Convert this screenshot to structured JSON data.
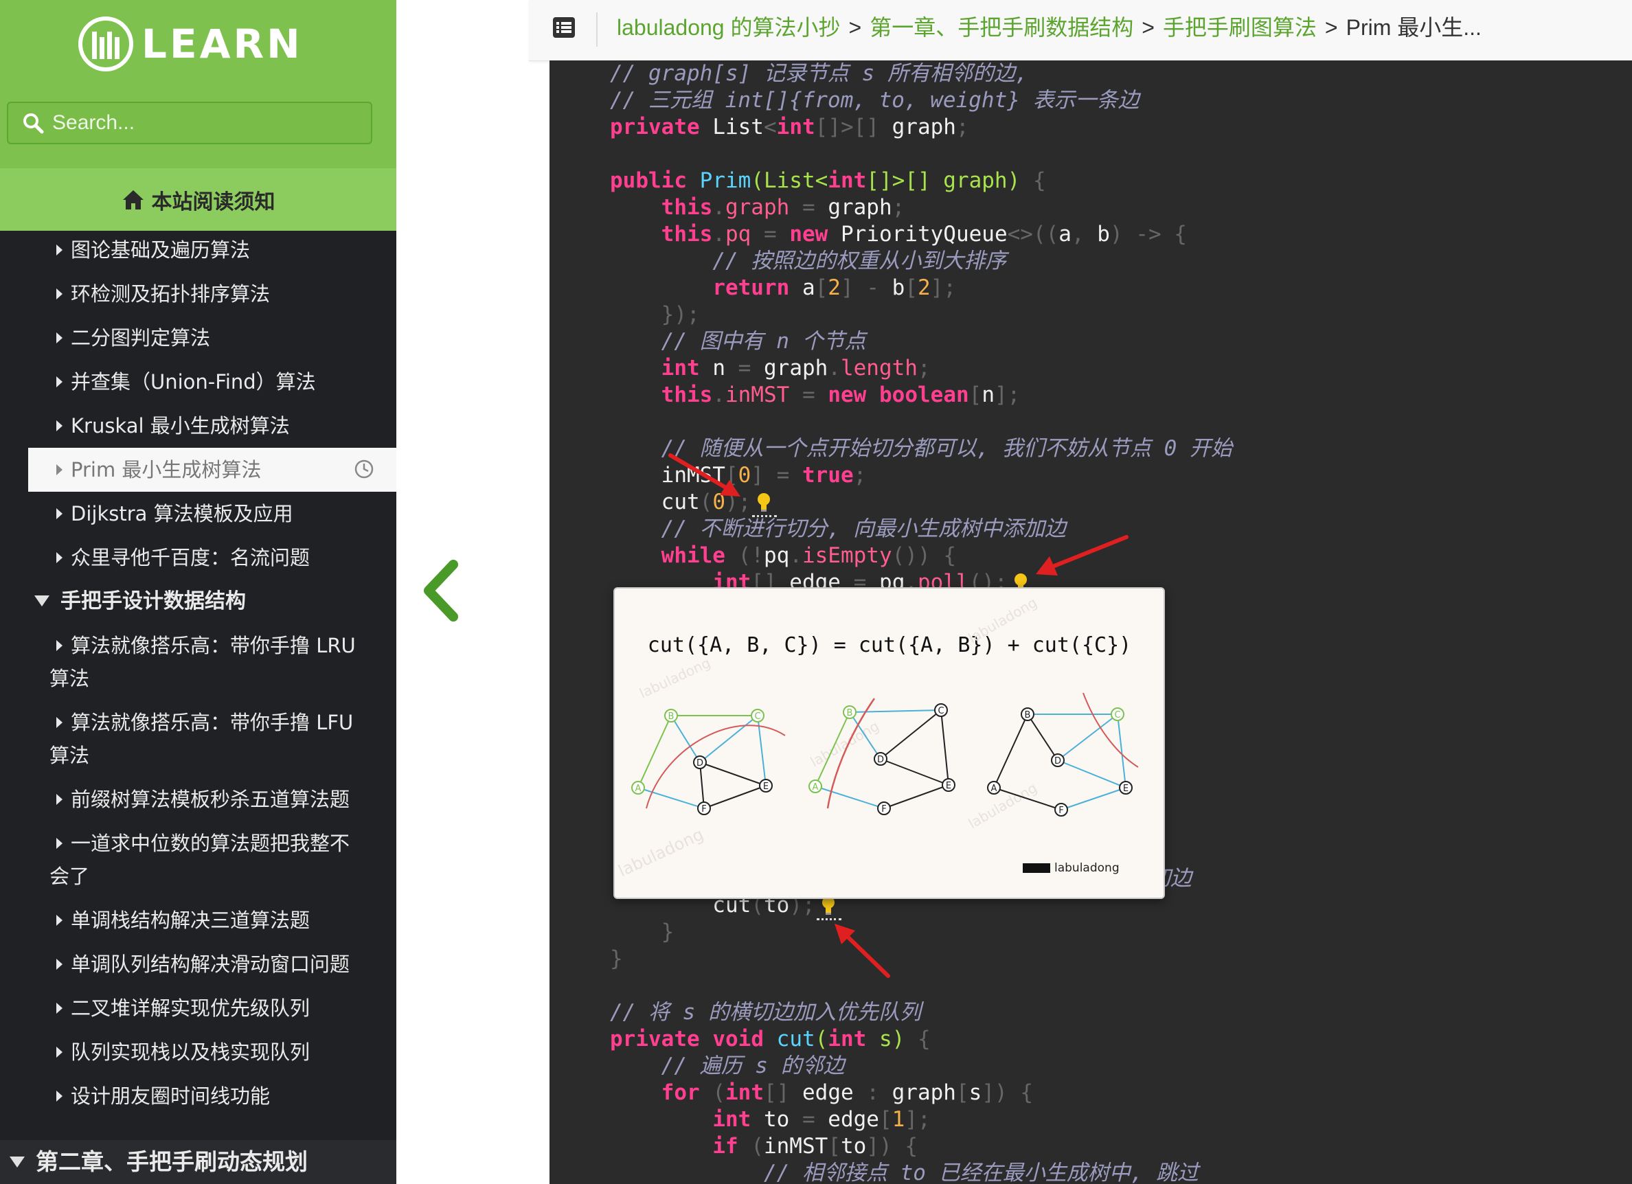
{
  "sidebar": {
    "logo_text": "LEARN",
    "search_placeholder": "Search...",
    "notice": "本站阅读须知",
    "items": [
      "图论基础及遍历算法",
      "环检测及拓扑排序算法",
      "二分图判定算法",
      "并查集（Union-Find）算法",
      "Kruskal 最小生成树算法",
      "Prim 最小生成树算法",
      "Dijkstra 算法模板及应用",
      "众里寻他千百度：名流问题"
    ],
    "section_title": "手把手设计数据结构",
    "section_items": [
      "算法就像搭乐高：带你手撸 LRU 算法",
      "算法就像搭乐高：带你手撸 LFU 算法",
      "前缀树算法模板秒杀五道算法题",
      "一道求中位数的算法题把我整不会了",
      "单调栈结构解决三道算法题",
      "单调队列结构解决滑动窗口问题",
      "二叉堆详解实现优先级队列",
      "队列实现栈以及栈实现队列",
      "设计朋友圈时间线功能"
    ],
    "chapter_title": "第二章、手把手刷动态规划"
  },
  "header": {
    "crumb1": "labuladong 的算法小抄",
    "crumb2": "第一章、手把手刷数据结构",
    "crumb3": "手把手刷图算法",
    "current": "Prim 最小生..."
  },
  "code": {
    "comment_graph": "// graph[s] 记录节点 s 所有相邻的边,",
    "comment_triple": "// 三元组 int[]{from, to, weight} 表示一条边",
    "comment_sort": "// 按照边的权重从小到大排序",
    "comment_n": "// 图中有 n 个节点",
    "comment_start": "// 随便从一个点开始切分都可以, 我们不妨从节点 0 开始",
    "comment_loop": "// 不断进行切分, 向最小生成树中添加边",
    "comment_partial": "更多横切边",
    "comment_add": "// 将 s 的横切边加入优先队列",
    "comment_adj": "// 遍历 s 的邻边",
    "comment_skip": "// 相邻接点 to 已经在最小生成树中, 跳过"
  },
  "popup": {
    "formula": "cut({A, B, C}) = cut({A, B}) + cut({C})",
    "credit": "labuladong",
    "watermark": "labuladong",
    "node_labels": [
      "A",
      "B",
      "C",
      "D",
      "E",
      "F"
    ]
  }
}
